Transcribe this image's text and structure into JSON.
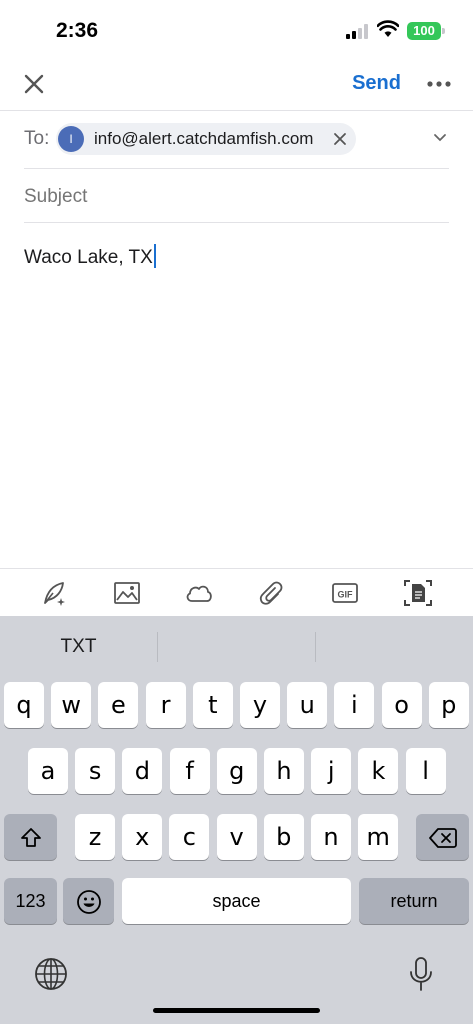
{
  "status_bar": {
    "time": "2:36",
    "battery": "100"
  },
  "header": {
    "send_label": "Send"
  },
  "recipient": {
    "to_label": "To:",
    "avatar_initial": "I",
    "email": "info@alert.catchdamfish.com"
  },
  "subject": {
    "placeholder": "Subject",
    "value": ""
  },
  "body": {
    "text": "Waco Lake, TX"
  },
  "toolbar": {
    "tools": [
      "compose-assist-icon",
      "image-icon",
      "cloud-icon",
      "paperclip-icon",
      "gif-icon",
      "document-scan-icon"
    ],
    "gif_label": "GIF"
  },
  "keyboard": {
    "suggestions": [
      "TXT",
      "",
      ""
    ],
    "row1": [
      "q",
      "w",
      "e",
      "r",
      "t",
      "y",
      "u",
      "i",
      "o",
      "p"
    ],
    "row2": [
      "a",
      "s",
      "d",
      "f",
      "g",
      "h",
      "j",
      "k",
      "l"
    ],
    "row3": [
      "z",
      "x",
      "c",
      "v",
      "b",
      "n",
      "m"
    ],
    "numbers_label": "123",
    "space_label": "space",
    "return_label": "return"
  },
  "colors": {
    "accent": "#1a6fd0",
    "battery": "#34c759",
    "keyboard_bg": "#d1d3d9"
  }
}
